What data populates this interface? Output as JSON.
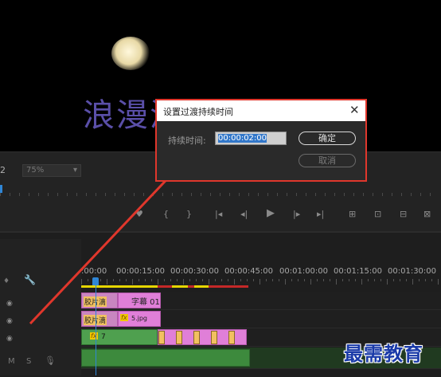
{
  "monitor": {
    "caption": "浪漫满屋"
  },
  "controls": {
    "timecode": "2",
    "zoom": "75%",
    "zoom_arrow": "▾"
  },
  "transport": {
    "buttons": [
      "♥",
      "{",
      "}",
      "|◂",
      "◂|",
      "▶",
      "|▸",
      "▸|",
      "⊞",
      "⊡",
      "⊟",
      "⊠",
      "⊞"
    ]
  },
  "timeline": {
    "ruler_labels": [
      ":00:00",
      "00:00:15:00",
      "00:00:30:00",
      "00:00:45:00",
      "00:01:00:00",
      "00:01:15:00",
      "00:01:30:00"
    ],
    "header_icons": {
      "link": "♦",
      "wrench": "🔧",
      "mute": "M",
      "solo": "S",
      "mic": "🎙"
    },
    "clips": {
      "title_clip": "字幕 01",
      "film1": "胶片滴",
      "film2": "胶片滴",
      "image_clip": "5.jpg",
      "video_clip": "7",
      "fx": "fx"
    }
  },
  "dialog": {
    "title": "设置过渡持续时间",
    "close": "✕",
    "duration_label": "持续时间:",
    "duration_value": "00:00:02:00",
    "ok": "确定",
    "cancel": "取消"
  },
  "watermark": "最需教育",
  "colors": {
    "highlight_border": "#e0372c",
    "clip_pink": "#e07fd8",
    "clip_green": "#3d8a3d",
    "playhead": "#2f86d6",
    "watermark": "#1a3aa8"
  }
}
